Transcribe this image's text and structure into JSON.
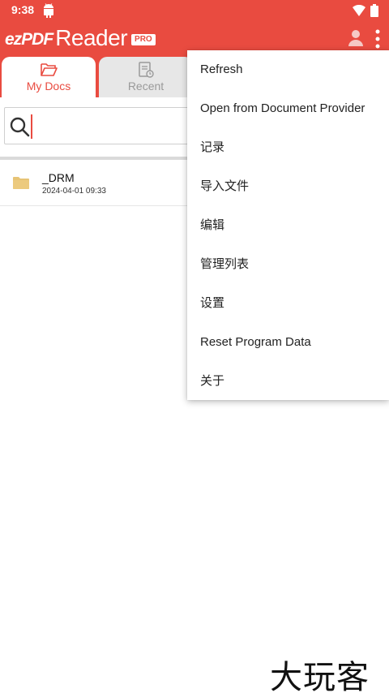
{
  "status_bar": {
    "time": "9:38"
  },
  "app_bar": {
    "logo_ez": "ezPDF",
    "logo_reader": "Reader",
    "logo_badge": "PRO"
  },
  "tabs": [
    {
      "label": "My Docs",
      "active": true
    },
    {
      "label": "Recent",
      "active": false
    }
  ],
  "search": {
    "value": "",
    "placeholder": ""
  },
  "files": [
    {
      "name": "_DRM",
      "date": "2024-04-01 09:33",
      "type": "folder"
    }
  ],
  "menu": {
    "items": [
      {
        "label": "Refresh"
      },
      {
        "label": "Open from Document Provider"
      },
      {
        "label": "记录"
      },
      {
        "label": "导入文件"
      },
      {
        "label": "编辑"
      },
      {
        "label": "管理列表"
      },
      {
        "label": "设置"
      },
      {
        "label": "Reset Program Data"
      },
      {
        "label": "关于"
      }
    ]
  },
  "watermark": {
    "text": "大玩客"
  },
  "colors": {
    "brand": "#e94b40",
    "folder": "#e7c475",
    "tab_inactive": "#e7e7e7"
  },
  "icons": [
    "android-icon",
    "wifi-icon",
    "battery-icon",
    "account-icon",
    "more-vert-icon",
    "folder-open-icon",
    "recent-docs-icon",
    "search-icon",
    "folder-icon"
  ]
}
